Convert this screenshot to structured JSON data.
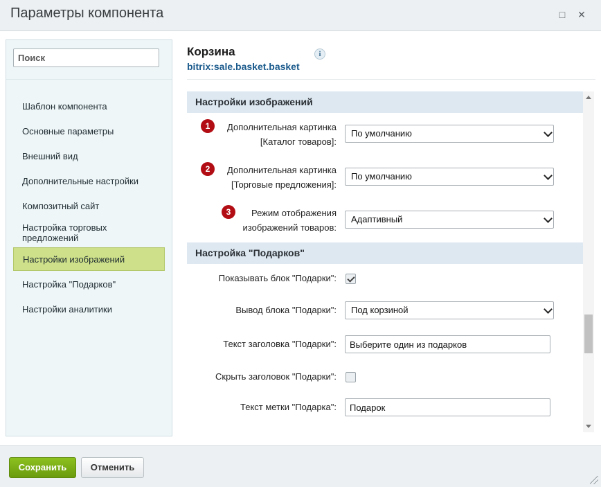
{
  "window": {
    "title": "Параметры компонента",
    "maximize_icon": "□",
    "close_icon": "✕"
  },
  "sidebar": {
    "search_placeholder": "Поиск",
    "items": [
      {
        "label": "Шаблон компонента"
      },
      {
        "label": "Основные параметры"
      },
      {
        "label": "Внешний вид"
      },
      {
        "label": "Дополнительные настройки"
      },
      {
        "label": "Композитный сайт"
      },
      {
        "label": "Настройка торговых предложений",
        "line1": "Настройка торговых",
        "line2": "предложений"
      },
      {
        "label": "Настройки изображений",
        "active": true
      },
      {
        "label": "Настройка \"Подарков\""
      },
      {
        "label": "Настройки аналитики"
      }
    ],
    "active_color": "#cee18a"
  },
  "component": {
    "name": "Корзина",
    "code": "bitrix:sale.basket.basket",
    "info_icon": "i"
  },
  "sections": {
    "images": {
      "title": "Настройки изображений",
      "rows": [
        {
          "badge": "1",
          "label_line1": "Дополнительная картинка",
          "label_line2": "[Каталог товаров]:",
          "value": "По умолчанию"
        },
        {
          "badge": "2",
          "label_line1": "Дополнительная картинка",
          "label_line2": "[Торговые предложения]:",
          "value": "По умолчанию"
        },
        {
          "badge": "3",
          "label_line1": "Режим отображения",
          "label_line2": "изображений товаров:",
          "value": "Адаптивный"
        }
      ]
    },
    "gifts": {
      "title": "Настройка \"Подарков\"",
      "show_block": {
        "label": "Показывать блок \"Подарки\":",
        "checked": true
      },
      "output_block": {
        "label": "Вывод блока \"Подарки\":",
        "value": "Под корзиной"
      },
      "header_text": {
        "label": "Текст заголовка \"Подарки\":",
        "value": "Выберите один из подарков"
      },
      "hide_header": {
        "label": "Скрыть заголовок \"Подарки\":",
        "checked": false
      },
      "gift_label": {
        "label": "Текст метки \"Подарка\":",
        "value": "Подарок"
      }
    }
  },
  "footer": {
    "save_label": "Сохранить",
    "cancel_label": "Отменить"
  },
  "colors": {
    "badge": "#b20d14",
    "save_button": "#7aad17",
    "section_header": "#dde8f1"
  }
}
